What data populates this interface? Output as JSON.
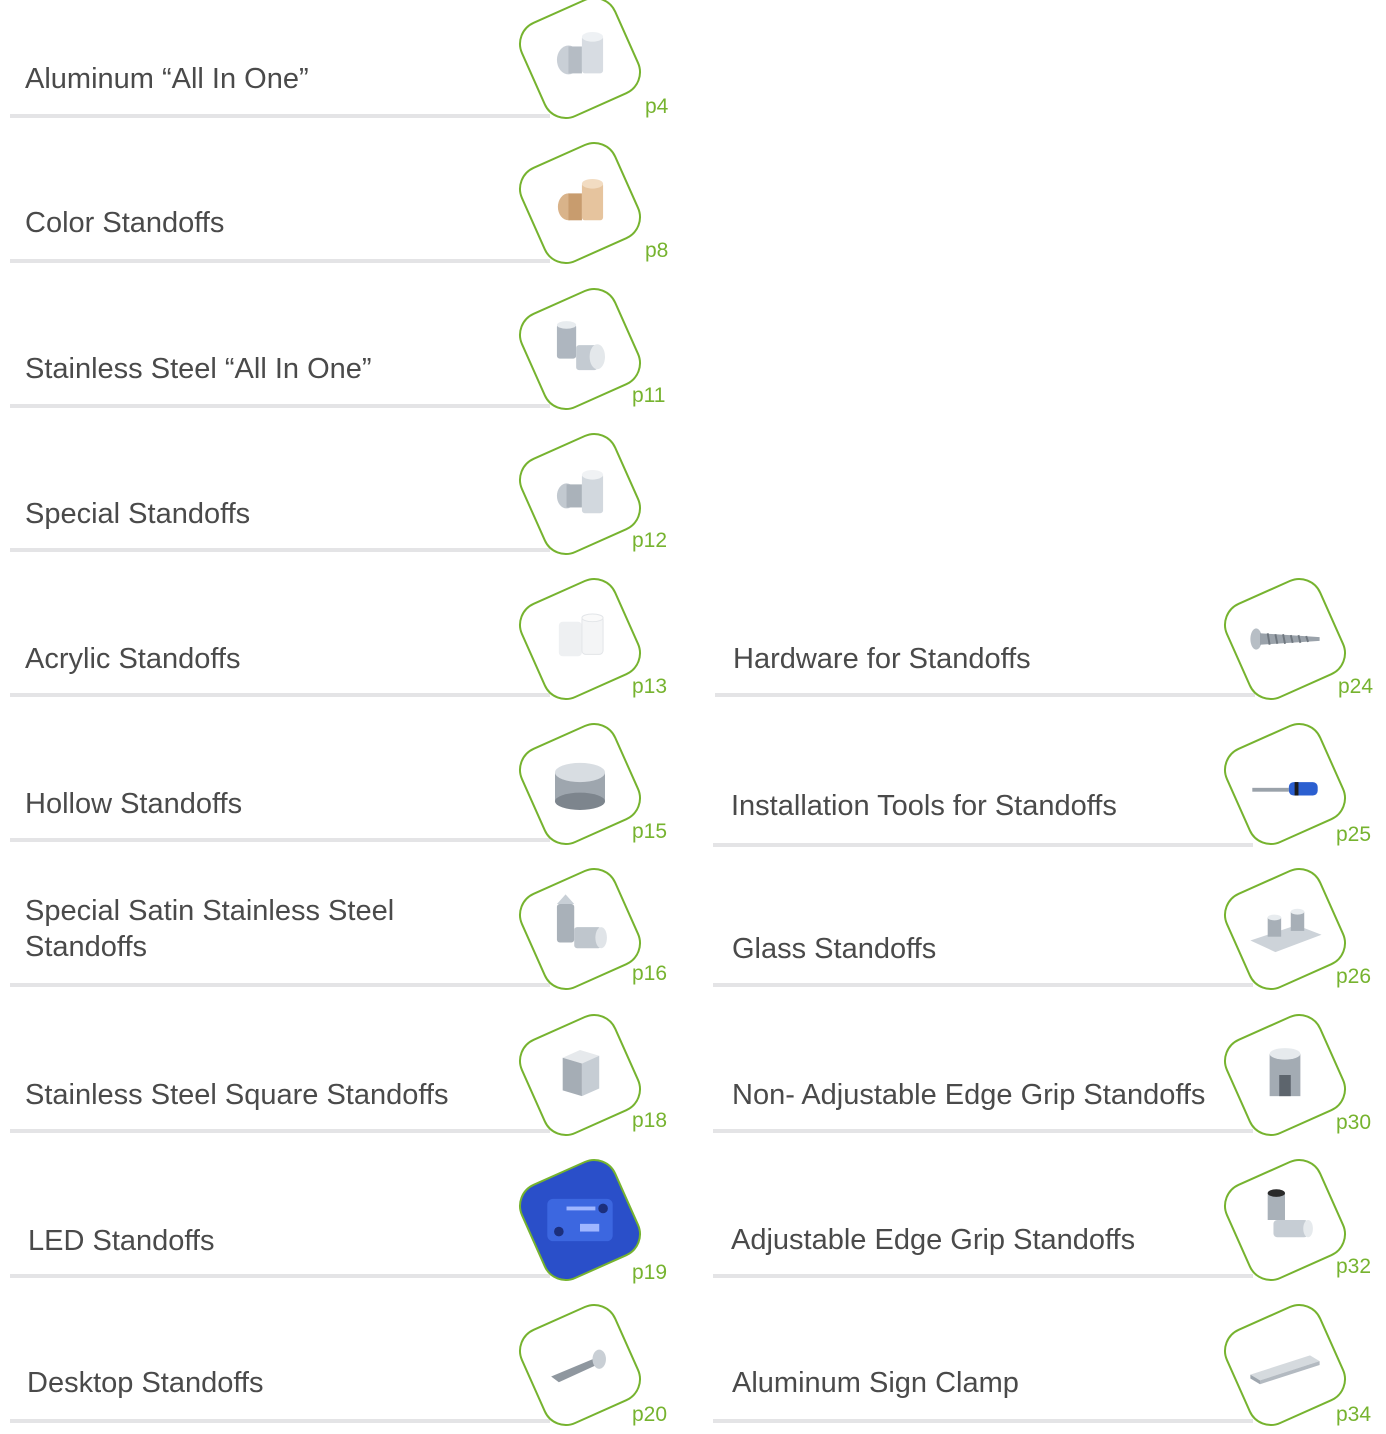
{
  "catalog": {
    "left": [
      {
        "title": "Aluminum “All In One”",
        "page": "p4",
        "icon": "aluminum-standoff-icon"
      },
      {
        "title": "Color Standoffs",
        "page": "p8",
        "icon": "color-standoff-icon"
      },
      {
        "title": "Stainless Steel “All In One”",
        "page": "p11",
        "icon": "stainless-standoff-icon"
      },
      {
        "title": "Special Standoffs",
        "page": "p12",
        "icon": "special-standoff-icon"
      },
      {
        "title": "Acrylic Standoffs",
        "page": "p13",
        "icon": "acrylic-standoff-icon"
      },
      {
        "title": "Hollow Standoffs",
        "page": "p15",
        "icon": "hollow-standoff-icon"
      },
      {
        "title": "Special Satin Stainless Steel Standoffs",
        "page": "p16",
        "icon": "satin-standoff-icon"
      },
      {
        "title": "Stainless Steel Square Standoffs",
        "page": "p18",
        "icon": "square-standoff-icon"
      },
      {
        "title": "LED Standoffs",
        "page": "p19",
        "icon": "led-standoff-icon"
      },
      {
        "title": "Desktop Standoffs",
        "page": "p20",
        "icon": "desktop-standoff-icon"
      }
    ],
    "right": [
      {
        "title": "Hardware for Standoffs",
        "page": "p24",
        "icon": "screw-icon"
      },
      {
        "title": "Installation Tools for Standoffs",
        "page": "p25",
        "icon": "screwdriver-icon"
      },
      {
        "title": "Glass Standoffs",
        "page": "p26",
        "icon": "glass-standoff-icon"
      },
      {
        "title": "Non- Adjustable Edge Grip Standoffs",
        "page": "p30",
        "icon": "edge-grip-icon"
      },
      {
        "title": "Adjustable Edge Grip Standoffs",
        "page": "p32",
        "icon": "adjustable-edge-grip-icon"
      },
      {
        "title": "Aluminum Sign Clamp",
        "page": "p34",
        "icon": "sign-clamp-icon"
      }
    ]
  },
  "colors": {
    "accent": "#76b32f",
    "text": "#4a4a4a",
    "rule": "#e4e4e6"
  }
}
